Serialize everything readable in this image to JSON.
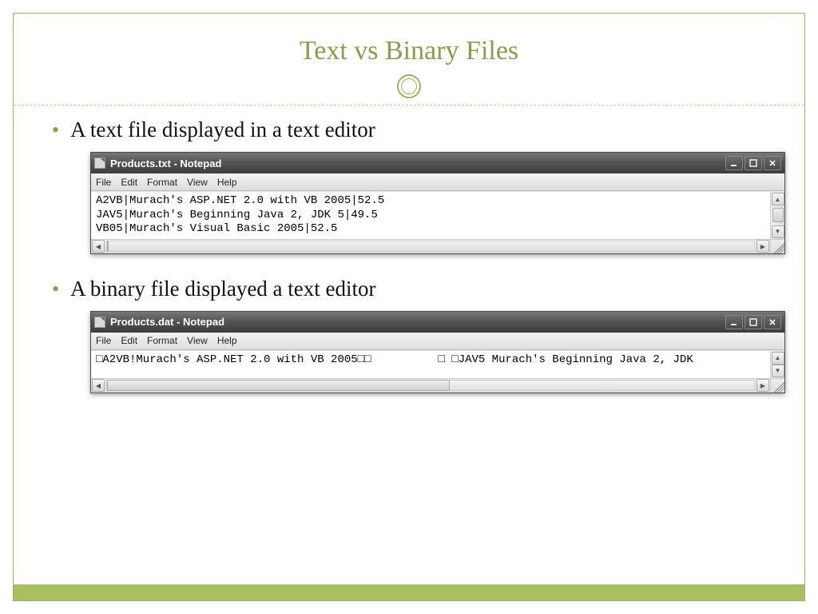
{
  "slide": {
    "title": "Text vs Binary Files",
    "bullets": [
      "A text file displayed in a text editor",
      "A binary file displayed a text editor"
    ]
  },
  "notepad_menus": [
    "File",
    "Edit",
    "Format",
    "View",
    "Help"
  ],
  "window1": {
    "title": "Products.txt - Notepad",
    "content": "A2VB|Murach's ASP.NET 2.0 with VB 2005|52.5\nJAV5|Murach's Beginning Java 2, JDK 5|49.5\nVB05|Murach's Visual Basic 2005|52.5",
    "hthumb_width": "0%"
  },
  "window2": {
    "title": "Products.dat - Notepad",
    "content": "□A2VB!Murach's ASP.NET 2.0 with VB 2005□□          □ □JAV5 Murach's Beginning Java 2, JDK",
    "hthumb_width": "53%"
  }
}
